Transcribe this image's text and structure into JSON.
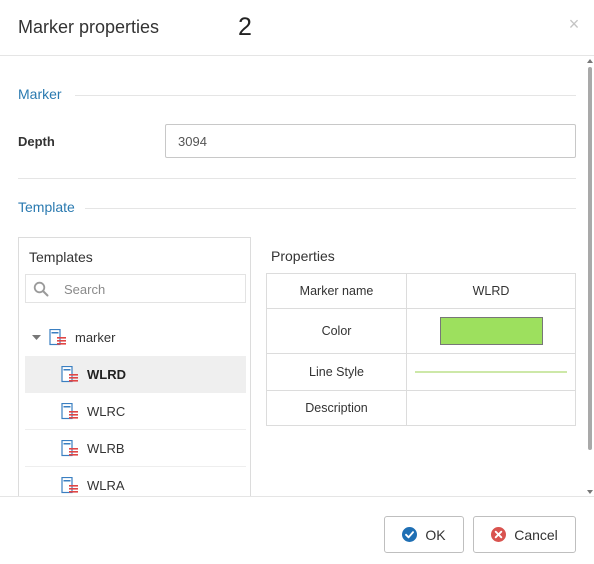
{
  "header": {
    "title": "Marker properties",
    "badge": "2",
    "close_glyph": "×"
  },
  "marker_section": {
    "heading": "Marker",
    "depth_label": "Depth",
    "depth_value": "3094"
  },
  "template_section": {
    "heading": "Template"
  },
  "templates": {
    "heading": "Templates",
    "search_placeholder": "Search",
    "tree": [
      {
        "label": "marker",
        "icon": "marker-template-icon",
        "expanded": true
      },
      {
        "label": "WLRD",
        "icon": "marker-template-icon",
        "selected": true
      },
      {
        "label": "WLRC",
        "icon": "marker-template-icon"
      },
      {
        "label": "WLRB",
        "icon": "marker-template-icon"
      },
      {
        "label": "WLRA",
        "icon": "marker-template-icon"
      }
    ]
  },
  "properties": {
    "heading": "Properties",
    "rows": [
      {
        "name": "Marker name",
        "value": "WLRD"
      },
      {
        "name": "Color",
        "color": "#9de05e"
      },
      {
        "name": "Line Style",
        "line_color": "#cde8a8"
      },
      {
        "name": "Description",
        "value": ""
      }
    ]
  },
  "footer": {
    "ok_label": "OK",
    "ok_icon": "check-circle-icon",
    "cancel_label": "Cancel",
    "cancel_icon": "x-circle-icon"
  },
  "colors": {
    "accent": "#2a7ab0",
    "ok_icon": "#1f6fb4",
    "cancel_icon": "#d9534f"
  }
}
